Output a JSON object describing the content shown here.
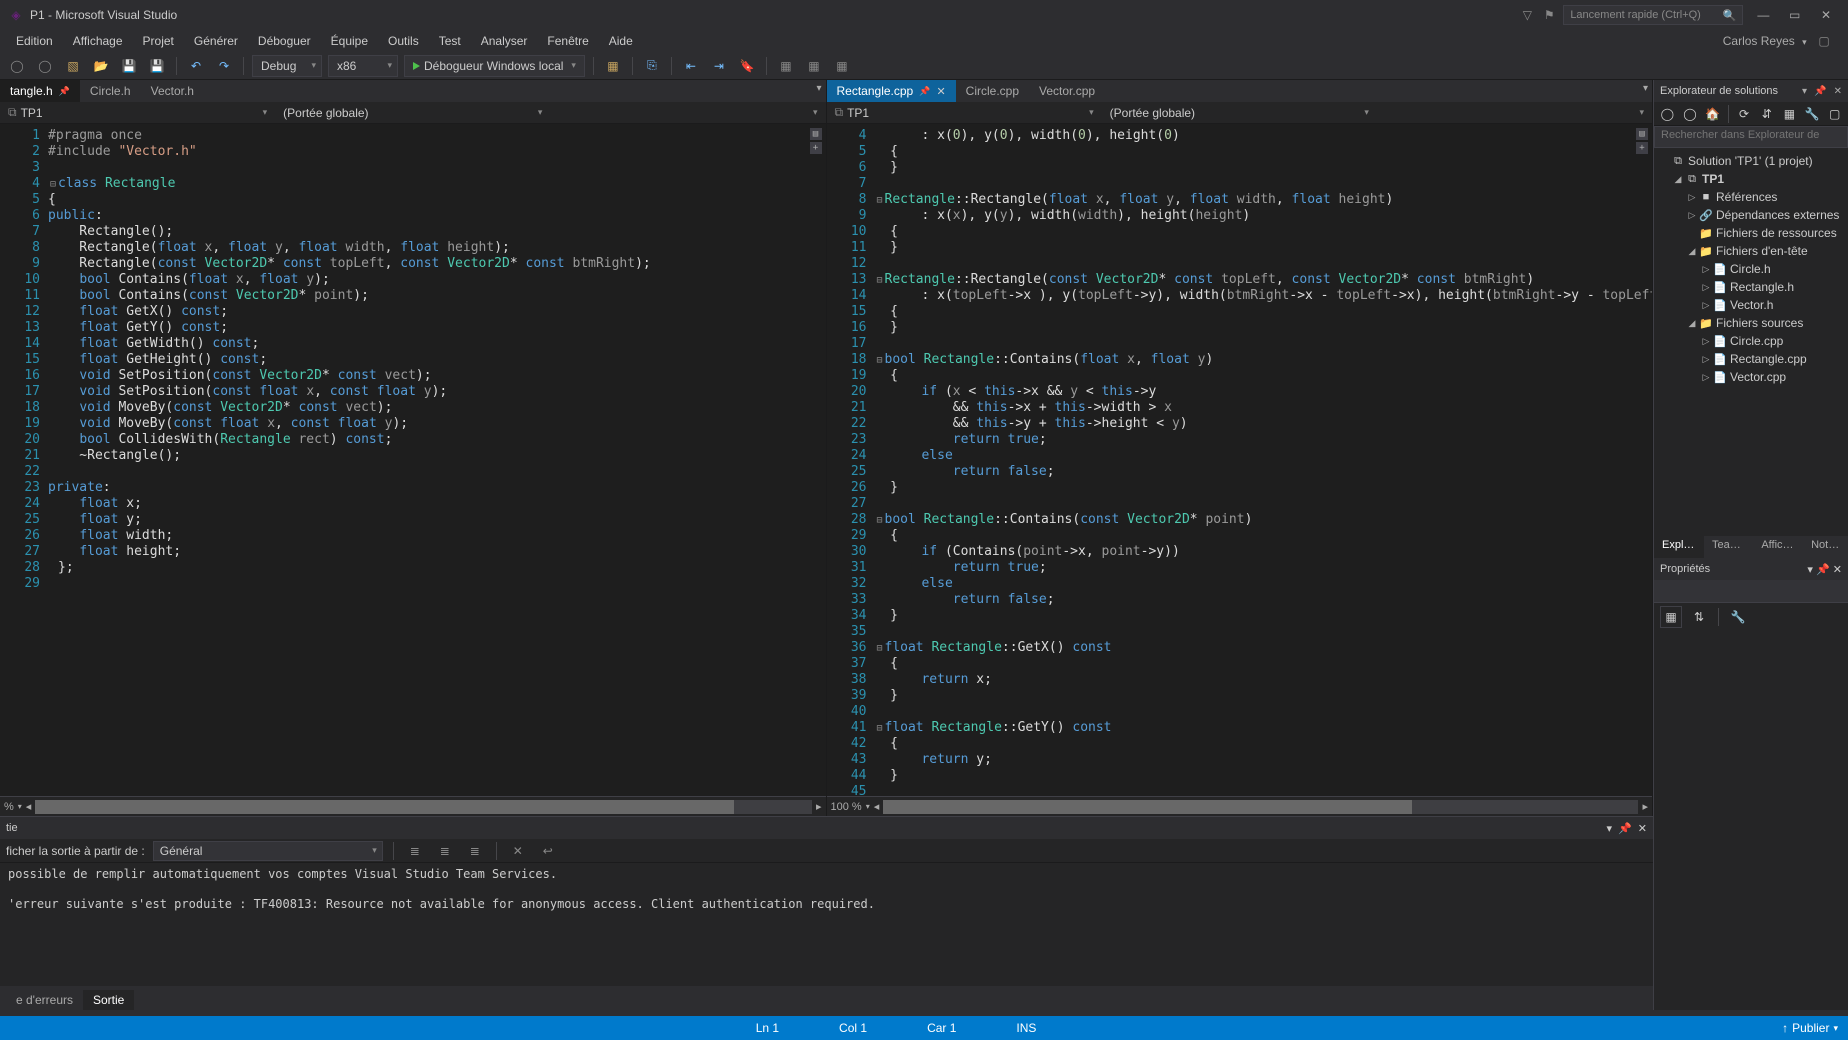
{
  "titlebar": {
    "title": "P1 - Microsoft Visual Studio",
    "searchPlaceholder": "Lancement rapide (Ctrl+Q)"
  },
  "menus": [
    "Edition",
    "Affichage",
    "Projet",
    "Générer",
    "Déboguer",
    "Équipe",
    "Outils",
    "Test",
    "Analyser",
    "Fenêtre",
    "Aide"
  ],
  "user": "Carlos Reyes",
  "toolbar": {
    "config": "Debug",
    "platform": "x86",
    "debugger": "Débogueur Windows local"
  },
  "leftPane": {
    "tabs": [
      {
        "label": "tangle.h",
        "active": true,
        "pinned": true
      },
      {
        "label": "Circle.h"
      },
      {
        "label": "Vector.h"
      }
    ],
    "scopeLeft": "TP1",
    "scopeMid": "(Portée globale)",
    "zoom": "%",
    "lines": [
      {
        "n": 1,
        "html": "<span class='prep'>#pragma once</span>"
      },
      {
        "n": 2,
        "html": "<span class='prep'>#include </span><span class='str'>\"Vector.h\"</span>"
      },
      {
        "n": 3,
        "html": ""
      },
      {
        "n": 4,
        "html": "<span class='fold'>⊟</span><span class='kw'>class</span> <span class='type'>Rectangle</span>"
      },
      {
        "n": 5,
        "html": "{"
      },
      {
        "n": 6,
        "html": "<span class='kw'>public</span>:"
      },
      {
        "n": 7,
        "html": "    Rectangle();"
      },
      {
        "n": 8,
        "html": "    Rectangle(<span class='kw'>float</span> <span class='param'>x</span>, <span class='kw'>float</span> <span class='param'>y</span>, <span class='kw'>float</span> <span class='param'>width</span>, <span class='kw'>float</span> <span class='param'>height</span>);"
      },
      {
        "n": 9,
        "html": "    Rectangle(<span class='kw'>const</span> <span class='type'>Vector2D</span>* <span class='kw'>const</span> <span class='param'>topLeft</span>, <span class='kw'>const</span> <span class='type'>Vector2D</span>* <span class='kw'>const</span> <span class='param'>btmRight</span>);"
      },
      {
        "n": 10,
        "html": "    <span class='kw'>bool</span> Contains(<span class='kw'>float</span> <span class='param'>x</span>, <span class='kw'>float</span> <span class='param'>y</span>);"
      },
      {
        "n": 11,
        "html": "    <span class='kw'>bool</span> Contains(<span class='kw'>const</span> <span class='type'>Vector2D</span>* <span class='param'>point</span>);"
      },
      {
        "n": 12,
        "html": "    <span class='kw'>float</span> GetX() <span class='kw'>const</span>;"
      },
      {
        "n": 13,
        "html": "    <span class='kw'>float</span> GetY() <span class='kw'>const</span>;"
      },
      {
        "n": 14,
        "html": "    <span class='kw'>float</span> GetWidth() <span class='kw'>const</span>;"
      },
      {
        "n": 15,
        "html": "    <span class='kw'>float</span> GetHeight() <span class='kw'>const</span>;"
      },
      {
        "n": 16,
        "html": "    <span class='kw'>void</span> SetPosition(<span class='kw'>const</span> <span class='type'>Vector2D</span>* <span class='kw'>const</span> <span class='param'>vect</span>);"
      },
      {
        "n": 17,
        "html": "    <span class='kw'>void</span> SetPosition(<span class='kw'>const</span> <span class='kw'>float</span> <span class='param'>x</span>, <span class='kw'>const</span> <span class='kw'>float</span> <span class='param'>y</span>);"
      },
      {
        "n": 18,
        "html": "    <span class='kw'>void</span> MoveBy(<span class='kw'>const</span> <span class='type'>Vector2D</span>* <span class='kw'>const</span> <span class='param'>vect</span>);"
      },
      {
        "n": 19,
        "html": "    <span class='kw'>void</span> MoveBy(<span class='kw'>const</span> <span class='kw'>float</span> <span class='param'>x</span>, <span class='kw'>const</span> <span class='kw'>float</span> <span class='param'>y</span>);"
      },
      {
        "n": 20,
        "html": "    <span class='kw'>bool</span> CollidesWith(<span class='type'>Rectangle</span> <span class='param'>rect</span>) <span class='kw'>const</span>;"
      },
      {
        "n": 21,
        "html": "    ~Rectangle();"
      },
      {
        "n": 22,
        "html": ""
      },
      {
        "n": 23,
        "html": "<span class='kw'>private</span>:"
      },
      {
        "n": 24,
        "html": "    <span class='kw'>float</span> x;"
      },
      {
        "n": 25,
        "html": "    <span class='kw'>float</span> y;"
      },
      {
        "n": 26,
        "html": "    <span class='kw'>float</span> width;"
      },
      {
        "n": 27,
        "html": "    <span class='kw'>float</span> height;"
      },
      {
        "n": 28,
        "html": "<span class='fold'> </span>};"
      },
      {
        "n": 29,
        "html": ""
      }
    ]
  },
  "rightPane": {
    "tabs": [
      {
        "label": "Rectangle.cpp",
        "active": true,
        "pinned": true,
        "closable": true
      },
      {
        "label": "Circle.cpp"
      },
      {
        "label": "Vector.cpp"
      }
    ],
    "scopeLeft": "TP1",
    "scopeMid": "(Portée globale)",
    "zoom": "100 %",
    "lines": [
      {
        "n": 4,
        "html": "      : x(<span class='num'>0</span>), y(<span class='num'>0</span>), width(<span class='num'>0</span>), height(<span class='num'>0</span>)"
      },
      {
        "n": 5,
        "html": "  {"
      },
      {
        "n": 6,
        "html": "  }"
      },
      {
        "n": 7,
        "html": ""
      },
      {
        "n": 8,
        "html": "<span class='fold'>⊟</span><span class='type'>Rectangle</span>::Rectangle(<span class='kw'>float</span> <span class='param'>x</span>, <span class='kw'>float</span> <span class='param'>y</span>, <span class='kw'>float</span> <span class='param'>width</span>, <span class='kw'>float</span> <span class='param'>height</span>)"
      },
      {
        "n": 9,
        "html": "      : x(<span class='param'>x</span>), y(<span class='param'>y</span>), width(<span class='param'>width</span>), height(<span class='param'>height</span>)"
      },
      {
        "n": 10,
        "html": "  {"
      },
      {
        "n": 11,
        "html": "  }"
      },
      {
        "n": 12,
        "html": ""
      },
      {
        "n": 13,
        "html": "<span class='fold'>⊟</span><span class='type'>Rectangle</span>::Rectangle(<span class='kw'>const</span> <span class='type'>Vector2D</span>* <span class='kw'>const</span> <span class='param'>topLeft</span>, <span class='kw'>const</span> <span class='type'>Vector2D</span>* <span class='kw'>const</span> <span class='param'>btmRight</span>)"
      },
      {
        "n": 14,
        "html": "      : x(<span class='param'>topLeft</span>-&gt;x ), y(<span class='param'>topLeft</span>-&gt;y), width(<span class='param'>btmRight</span>-&gt;x - <span class='param'>topLeft</span>-&gt;x), height(<span class='param'>btmRight</span>-&gt;y - <span class='param'>topLeft</span>-&gt;y)"
      },
      {
        "n": 15,
        "html": "  {"
      },
      {
        "n": 16,
        "html": "  }"
      },
      {
        "n": 17,
        "html": ""
      },
      {
        "n": 18,
        "html": "<span class='fold'>⊟</span><span class='kw'>bool</span> <span class='type'>Rectangle</span>::Contains(<span class='kw'>float</span> <span class='param'>x</span>, <span class='kw'>float</span> <span class='param'>y</span>)"
      },
      {
        "n": 19,
        "html": "  {"
      },
      {
        "n": 20,
        "html": "      <span class='kw'>if</span> (<span class='param'>x</span> &lt; <span class='kw'>this</span>-&gt;x &amp;&amp; <span class='param'>y</span> &lt; <span class='kw'>this</span>-&gt;y"
      },
      {
        "n": 21,
        "html": "          &amp;&amp; <span class='kw'>this</span>-&gt;x + <span class='kw'>this</span>-&gt;width &gt; <span class='param'>x</span>"
      },
      {
        "n": 22,
        "html": "          &amp;&amp; <span class='kw'>this</span>-&gt;y + <span class='kw'>this</span>-&gt;height &lt; <span class='param'>y</span>)"
      },
      {
        "n": 23,
        "html": "          <span class='kw'>return</span> <span class='kw'>true</span>;"
      },
      {
        "n": 24,
        "html": "      <span class='kw'>else</span>"
      },
      {
        "n": 25,
        "html": "          <span class='kw'>return</span> <span class='kw'>false</span>;"
      },
      {
        "n": 26,
        "html": "  }"
      },
      {
        "n": 27,
        "html": ""
      },
      {
        "n": 28,
        "html": "<span class='fold'>⊟</span><span class='kw'>bool</span> <span class='type'>Rectangle</span>::Contains(<span class='kw'>const</span> <span class='type'>Vector2D</span>* <span class='param'>point</span>)"
      },
      {
        "n": 29,
        "html": "  {"
      },
      {
        "n": 30,
        "html": "      <span class='kw'>if</span> (Contains(<span class='param'>point</span>-&gt;x, <span class='param'>point</span>-&gt;y))"
      },
      {
        "n": 31,
        "html": "          <span class='kw'>return</span> <span class='kw'>true</span>;"
      },
      {
        "n": 32,
        "html": "      <span class='kw'>else</span>"
      },
      {
        "n": 33,
        "html": "          <span class='kw'>return</span> <span class='kw'>false</span>;"
      },
      {
        "n": 34,
        "html": "  }"
      },
      {
        "n": 35,
        "html": ""
      },
      {
        "n": 36,
        "html": "<span class='fold'>⊟</span><span class='kw'>float</span> <span class='type'>Rectangle</span>::GetX() <span class='kw'>const</span>"
      },
      {
        "n": 37,
        "html": "  {"
      },
      {
        "n": 38,
        "html": "      <span class='kw'>return</span> x;"
      },
      {
        "n": 39,
        "html": "  }"
      },
      {
        "n": 40,
        "html": ""
      },
      {
        "n": 41,
        "html": "<span class='fold'>⊟</span><span class='kw'>float</span> <span class='type'>Rectangle</span>::GetY() <span class='kw'>const</span>"
      },
      {
        "n": 42,
        "html": "  {"
      },
      {
        "n": 43,
        "html": "      <span class='kw'>return</span> y;"
      },
      {
        "n": 44,
        "html": "  }"
      },
      {
        "n": 45,
        "html": ""
      }
    ]
  },
  "solution": {
    "title": "Explorateur de solutions",
    "searchPlaceholder": "Rechercher dans Explorateur de",
    "nodes": [
      {
        "depth": 0,
        "exp": "",
        "ico": "⧉",
        "label": "Solution 'TP1' (1 projet)"
      },
      {
        "depth": 1,
        "exp": "◢",
        "ico": "⧉",
        "label": "TP1",
        "bold": true
      },
      {
        "depth": 2,
        "exp": "▷",
        "ico": "■",
        "label": "Références"
      },
      {
        "depth": 2,
        "exp": "▷",
        "ico": "🔗",
        "label": "Dépendances externes"
      },
      {
        "depth": 2,
        "exp": "",
        "ico": "📁",
        "label": "Fichiers de ressources"
      },
      {
        "depth": 2,
        "exp": "◢",
        "ico": "📁",
        "label": "Fichiers d'en-tête"
      },
      {
        "depth": 3,
        "exp": "▷",
        "ico": "📄",
        "label": "Circle.h"
      },
      {
        "depth": 3,
        "exp": "▷",
        "ico": "📄",
        "label": "Rectangle.h"
      },
      {
        "depth": 3,
        "exp": "▷",
        "ico": "📄",
        "label": "Vector.h"
      },
      {
        "depth": 2,
        "exp": "◢",
        "ico": "📁",
        "label": "Fichiers sources"
      },
      {
        "depth": 3,
        "exp": "▷",
        "ico": "📄",
        "label": "Circle.cpp"
      },
      {
        "depth": 3,
        "exp": "▷",
        "ico": "📄",
        "label": "Rectangle.cpp"
      },
      {
        "depth": 3,
        "exp": "▷",
        "ico": "📄",
        "label": "Vector.cpp"
      }
    ]
  },
  "sideTabs": [
    "Explo...",
    "Team...",
    "Affich...",
    "Notifi.."
  ],
  "sideTabsActive": 0,
  "props": {
    "title": "Propriétés"
  },
  "output": {
    "title": "tie",
    "sourceLabel": "ficher la sortie à partir de :",
    "sourceValue": "Général",
    "body": [
      "possible de remplir automatiquement vos comptes Visual Studio Team Services.",
      "",
      "'erreur suivante s'est produite : TF400813: Resource not available for anonymous access. Client authentication required."
    ]
  },
  "bottomTabs": [
    {
      "label": "e d'erreurs"
    },
    {
      "label": "Sortie",
      "active": true
    }
  ],
  "status": {
    "ln": "Ln 1",
    "col": "Col 1",
    "car": "Car 1",
    "ins": "INS",
    "publish": "Publier"
  }
}
